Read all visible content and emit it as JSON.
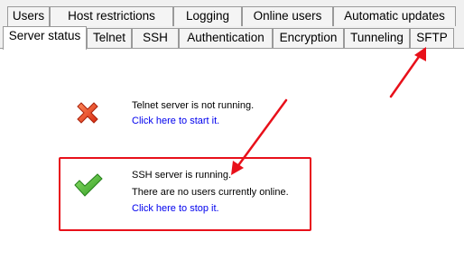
{
  "tabs_back": [
    "Users",
    "Host restrictions",
    "Logging",
    "Online users",
    "Automatic updates"
  ],
  "tabs_front": [
    "Server status",
    "Telnet",
    "SSH",
    "Authentication",
    "Encryption",
    "Tunneling",
    "SFTP"
  ],
  "active_tab": "Server status",
  "telnet": {
    "status": "Telnet server is not running.",
    "action": "Click here to start it.",
    "icon": "red-x-icon"
  },
  "ssh": {
    "status": "SSH server is running.",
    "users": "There are no users currently online.",
    "action": "Click here to stop it.",
    "icon": "green-check-icon"
  },
  "annotation_color": "#e8101a"
}
